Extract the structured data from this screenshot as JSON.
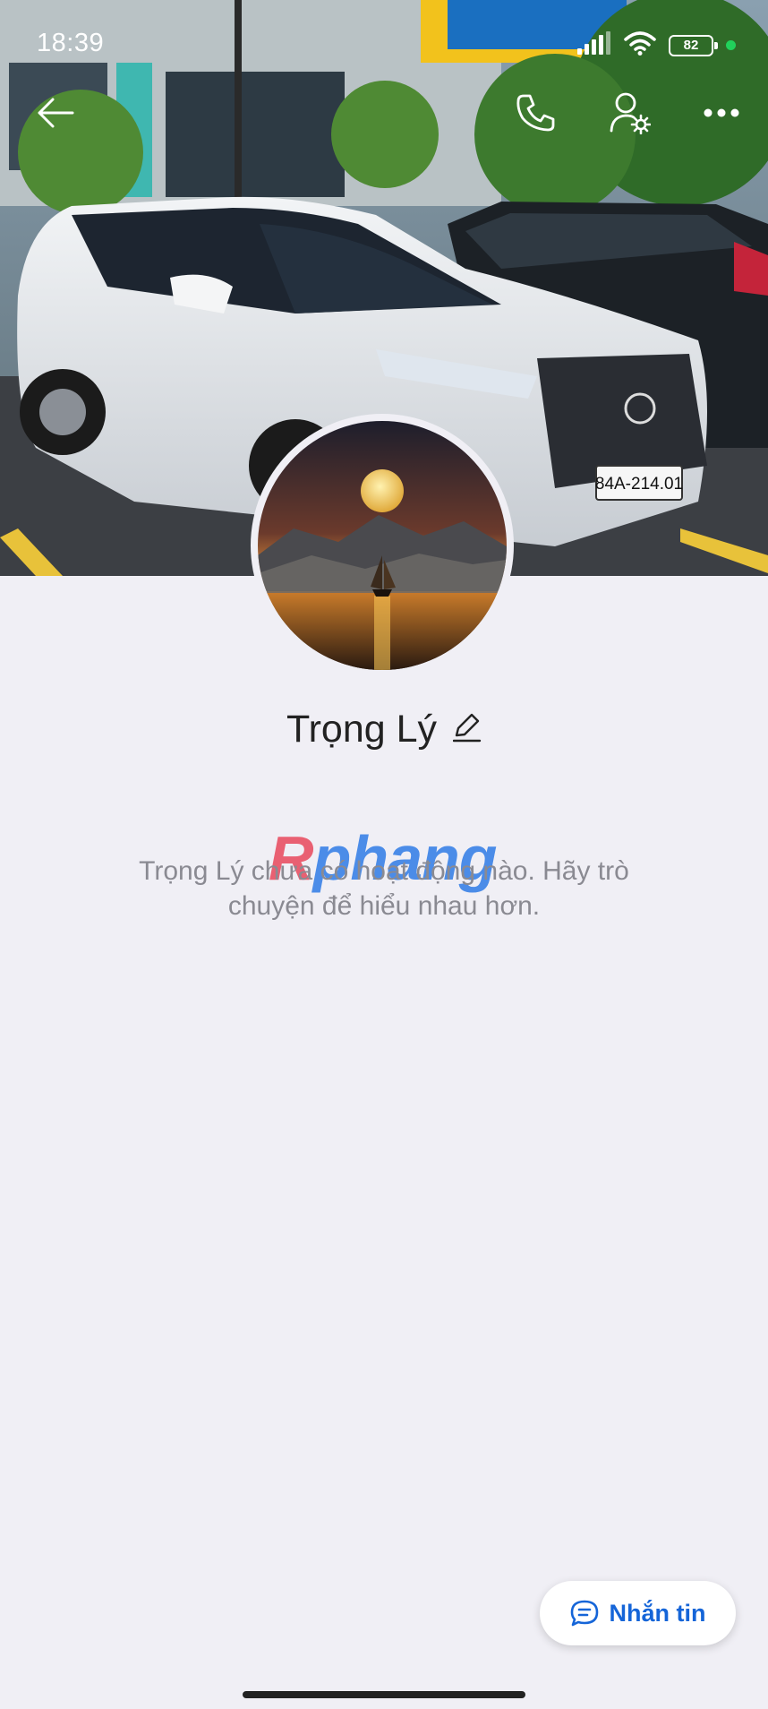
{
  "status_bar": {
    "time": "18:39",
    "battery": "82"
  },
  "profile": {
    "name": "Trọng Lý",
    "empty_message": "Trọng Lý chưa có hoạt động nào. Hãy trò chuyện để hiểu nhau hơn."
  },
  "watermark": {
    "red_part": "R",
    "blue_part": "phang"
  },
  "actions": {
    "message_button": "Nhắn tin"
  },
  "cover": {
    "plate": "84A-214.01"
  },
  "colors": {
    "accent": "#1565d8",
    "background": "#f0eff5",
    "status_dot": "#21d15b"
  },
  "icons": [
    "back-arrow-icon",
    "phone-icon",
    "user-settings-icon",
    "more-icon",
    "edit-pencil-icon",
    "chat-bubble-icon",
    "signal-icon",
    "wifi-icon",
    "battery-icon"
  ]
}
